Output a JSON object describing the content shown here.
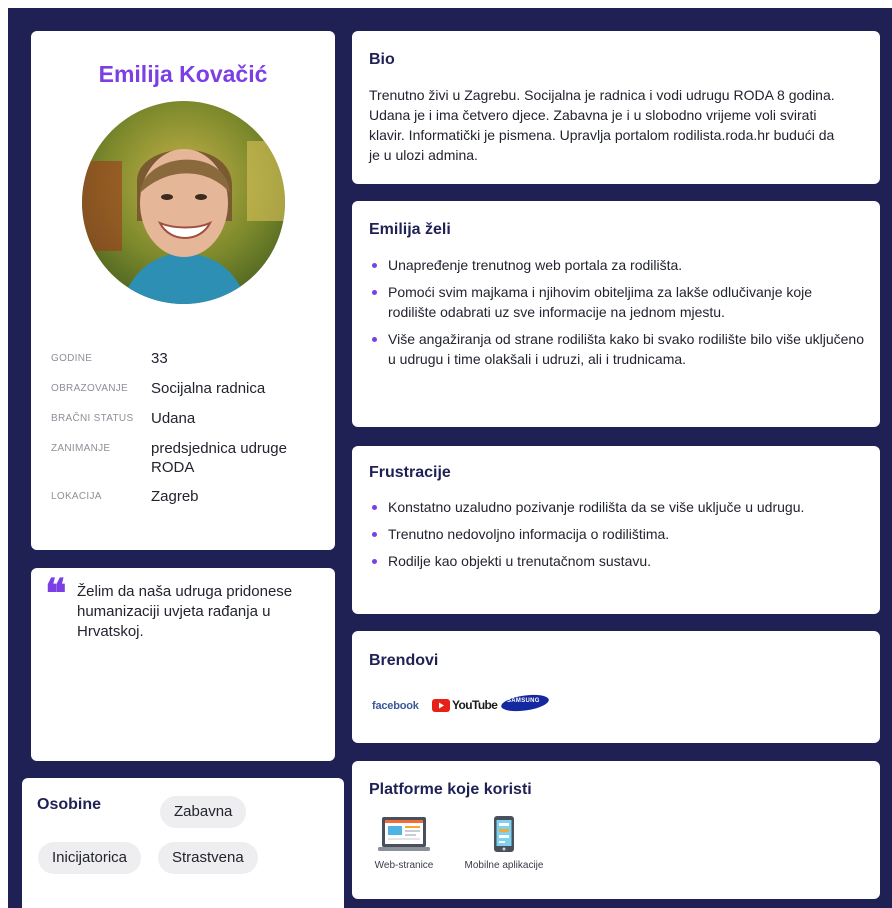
{
  "profile": {
    "name": "Emilija Kovačić",
    "facts": [
      {
        "label": "GODINE",
        "value": "33"
      },
      {
        "label": "OBRAZOVANJE",
        "value": "Socijalna radnica"
      },
      {
        "label": "BRAČNI STATUS",
        "value": "Udana"
      },
      {
        "label": "ZANIMANJE",
        "value": "predsjednica udruge RODA"
      },
      {
        "label": "LOKACIJA",
        "value": "Zagreb"
      }
    ]
  },
  "quote": {
    "mark": "❝",
    "text": "Želim da naša udruga pridonese humanizaciji uvjeta rađanja u Hrvatskoj."
  },
  "traits": {
    "title": "Osobine",
    "tags": [
      "Zabavna",
      "Inicijatorica",
      "Strastvena"
    ]
  },
  "bio": {
    "title": "Bio",
    "text": "Trenutno živi u Zagrebu. Socijalna je radnica i vodi udrugu RODA 8 godina. Udana je i ima četvero djece. Zabavna je i u slobodno vrijeme voli svirati klavir. Informatički je pismena. Upravlja portalom rodilista.roda.hr budući da je u ulozi admina."
  },
  "wants": {
    "title": "Emilija želi",
    "items": [
      "Unapređenje trenutnog web portala za rodilišta.",
      "Pomoći svim majkama i njihovim obiteljima za lakše odlučivanje koje rodilište odabrati uz sve informacije na jednom mjestu.",
      "Više angažiranja od strane rodilišta kako bi svako rodilište bilo više uključeno u udrugu i time olakšali i udruzi, ali i trudnicama."
    ]
  },
  "frustrations": {
    "title": "Frustracije",
    "items": [
      "Konstatno uzaludno pozivanje rodilišta da se više uključe u udrugu.",
      "Trenutno nedovoljno informacija o rodilištima.",
      "Rodilje kao objekti u trenutačnom sustavu."
    ]
  },
  "brands": {
    "title": "Brendovi",
    "logos": [
      {
        "name": "facebook-logo",
        "text": "facebook",
        "color": "#3b5998"
      },
      {
        "name": "youtube-logo",
        "text": "YouTube",
        "color": "#e62117"
      },
      {
        "name": "samsung-logo",
        "text": "SAMSUNG",
        "color": "#1428a0"
      }
    ]
  },
  "platforms": {
    "title": "Platforme koje koristi",
    "items": [
      {
        "icon": "web-browser-icon",
        "label": "Web-stranice"
      },
      {
        "icon": "mobile-phone-icon",
        "label": "Mobilne aplikacije"
      }
    ]
  },
  "colors": {
    "background": "#1f2155",
    "accent": "#7b3fe4",
    "card": "#ffffff",
    "tag": "#eeeef1"
  }
}
